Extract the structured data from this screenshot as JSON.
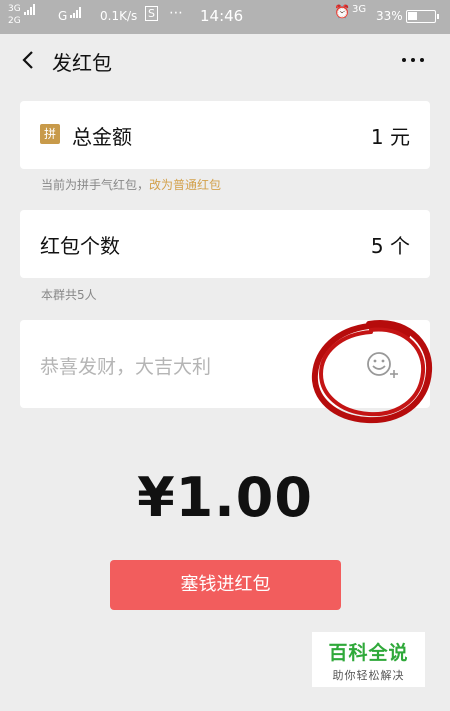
{
  "status_bar": {
    "net1": "3G",
    "net2": "2G",
    "net3": "G",
    "speed": "0.1K/s",
    "time": "14:46",
    "net4": "3G",
    "battery": "33%"
  },
  "nav": {
    "title": "发红包"
  },
  "total": {
    "badge": "拼",
    "label": "总金额",
    "value": "1 元"
  },
  "hint1": {
    "text": "当前为拼手气红包，",
    "link": "改为普通红包"
  },
  "count": {
    "label": "红包个数",
    "value": "5 个"
  },
  "hint2": "本群共5人",
  "greeting": {
    "placeholder": "恭喜发财，大吉大利"
  },
  "amount": "¥1.00",
  "send_button": "塞钱进红包",
  "watermark": {
    "title": "百科全说",
    "subtitle": "助你轻松解决"
  },
  "colors": {
    "accent_red": "#f25d5d",
    "badge_gold": "#c89a4a",
    "link_gold": "#d3a14c",
    "annotation_red": "#b60c0c"
  }
}
